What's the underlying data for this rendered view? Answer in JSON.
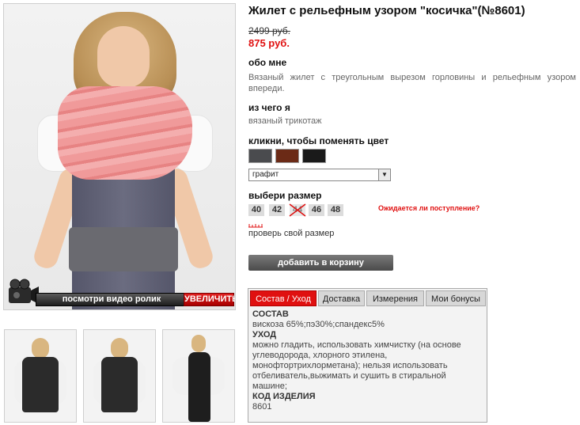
{
  "product": {
    "title": "Жилет с рельефным узором \"косичка\"(№8601)",
    "old_price": "2499 руб.",
    "new_price": "875 руб."
  },
  "about": {
    "heading": "обо мне",
    "text": "Вязаный жилет с треугольным вырезом горловины и рельефным узором впереди."
  },
  "material": {
    "heading": "из чего я",
    "text": "вязаный трикотаж"
  },
  "color": {
    "heading": "кликни, чтобы поменять цвет",
    "swatches": [
      "#4a4b4e",
      "#6b2a16",
      "#1a1a1a"
    ],
    "selected": "графит"
  },
  "size": {
    "heading": "выбери размер",
    "options": [
      "40",
      "42",
      "44",
      "46",
      "48"
    ],
    "unavailable": "44",
    "waiting_link": "Ожидается ли поступление?",
    "check_link": "проверь свой размер"
  },
  "cart": {
    "add_label": "добавить в корзину"
  },
  "photo": {
    "video_label": "посмотри видео ролик",
    "enlarge_label": "УВЕЛИЧИТЬ"
  },
  "tabs": {
    "items": [
      "Состав / Уход",
      "Доставка",
      "Измерения",
      "Мои бонусы"
    ],
    "active": "Состав / Уход"
  },
  "composition": {
    "heading": "СОСТАВ",
    "text": "вискоза 65%;пэ30%;спандекс5%",
    "care_heading": "УХОД",
    "care_text": "можно гладить, использовать химчистку (на основе углеводорода, хлорного этилена, монофтортрихлорметана); нельзя использовать отбеливатель,выжимать и сушить в стиральной машине;",
    "code_heading": "КОД ИЗДЕЛИЯ",
    "code": "8601"
  },
  "colors": {
    "accent": "#e01010",
    "button": "#5a5a5a"
  }
}
